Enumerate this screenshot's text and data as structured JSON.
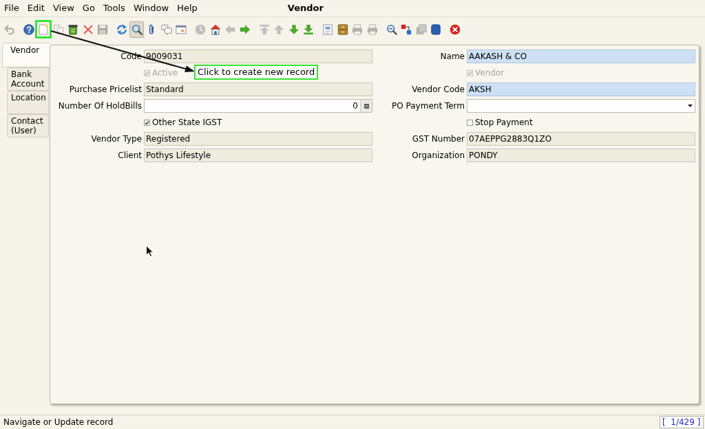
{
  "window": {
    "title": "Vendor"
  },
  "menu": [
    "File",
    "Edit",
    "View",
    "Go",
    "Tools",
    "Window",
    "Help"
  ],
  "toolbar": {
    "groups": [
      {
        "buttons": [
          {
            "disabled": true,
            "pressed": false,
            "highlighted": false
          }
        ]
      },
      {
        "buttons": [
          {
            "disabled": false,
            "pressed": false,
            "highlighted": false
          },
          {
            "disabled": false,
            "pressed": false,
            "highlighted": true
          },
          {
            "disabled": true,
            "pressed": false,
            "highlighted": false
          },
          {
            "disabled": false,
            "pressed": false,
            "highlighted": false
          },
          {
            "disabled": false,
            "pressed": false,
            "highlighted": false
          },
          {
            "disabled": true,
            "pressed": false,
            "highlighted": false
          }
        ]
      },
      {
        "buttons": [
          {
            "disabled": false,
            "pressed": false,
            "highlighted": false
          },
          {
            "disabled": false,
            "pressed": true,
            "highlighted": false
          },
          {
            "disabled": false,
            "pressed": false,
            "highlighted": false
          },
          {
            "disabled": false,
            "pressed": false,
            "highlighted": false
          },
          {
            "disabled": false,
            "pressed": false,
            "highlighted": false
          }
        ]
      },
      {
        "buttons": [
          {
            "disabled": true,
            "pressed": false,
            "highlighted": false
          },
          {
            "disabled": false,
            "pressed": false,
            "highlighted": false
          },
          {
            "disabled": true,
            "pressed": false,
            "highlighted": false
          },
          {
            "disabled": false,
            "pressed": false,
            "highlighted": false
          }
        ]
      },
      {
        "buttons": [
          {
            "disabled": true,
            "pressed": false,
            "highlighted": false
          },
          {
            "disabled": true,
            "pressed": false,
            "highlighted": false
          },
          {
            "disabled": false,
            "pressed": false,
            "highlighted": false
          },
          {
            "disabled": false,
            "pressed": false,
            "highlighted": false
          }
        ]
      },
      {
        "buttons": [
          {
            "disabled": false,
            "pressed": false,
            "highlighted": false
          },
          {
            "disabled": false,
            "pressed": false,
            "highlighted": false
          },
          {
            "disabled": true,
            "pressed": false,
            "highlighted": false
          },
          {
            "disabled": true,
            "pressed": false,
            "highlighted": false
          }
        ]
      },
      {
        "buttons": [
          {
            "disabled": false,
            "pressed": false,
            "highlighted": false
          },
          {
            "disabled": false,
            "pressed": false,
            "highlighted": false
          },
          {
            "disabled": true,
            "pressed": false,
            "highlighted": false
          },
          {
            "disabled": false,
            "pressed": false,
            "highlighted": false
          }
        ]
      },
      {
        "buttons": [
          {
            "disabled": false,
            "pressed": false,
            "highlighted": false
          }
        ]
      }
    ]
  },
  "tabs": [
    {
      "label": "Vendor",
      "selected": true
    },
    {
      "label": "Bank Account",
      "selected": false
    },
    {
      "label": "Location",
      "selected": false
    },
    {
      "label": "Contact (User)",
      "selected": false
    }
  ],
  "fields": [
    {
      "kind": "text",
      "label": "Code",
      "value": "9009031",
      "read_only": true,
      "mandatory": false
    },
    {
      "kind": "text",
      "label": "Name",
      "value": "AAKASH & CO",
      "read_only": false,
      "mandatory": true
    },
    {
      "kind": "checkbox",
      "label": "Active",
      "checked": true,
      "disabled": true
    },
    {
      "kind": "checkbox",
      "label": "Vendor",
      "checked": true,
      "disabled": true
    },
    {
      "kind": "text",
      "label": "Purchase Pricelist",
      "value": "Standard",
      "read_only": true,
      "mandatory": false
    },
    {
      "kind": "text",
      "label": "Vendor Code",
      "value": "AKSH",
      "read_only": false,
      "mandatory": true
    },
    {
      "kind": "number",
      "label": "Number Of HoldBills",
      "value": "0",
      "read_only": false,
      "mandatory": false
    },
    {
      "kind": "select",
      "label": "PO Payment Term",
      "read_only": false,
      "mandatory": false
    },
    {
      "kind": "checkbox",
      "label": "Other State IGST",
      "checked": true,
      "disabled": false
    },
    {
      "kind": "checkbox",
      "label": "Stop Payment",
      "checked": false,
      "disabled": false
    },
    {
      "kind": "text",
      "label": "Vendor Type",
      "value": "Registered",
      "read_only": true,
      "mandatory": false
    },
    {
      "kind": "text",
      "label": "GST Number",
      "value": "07AEPPG2883Q1ZO",
      "read_only": true,
      "mandatory": false
    },
    {
      "kind": "text",
      "label": "Client",
      "value": "Pothys Lifestyle",
      "read_only": true,
      "mandatory": false
    },
    {
      "kind": "text",
      "label": "Organization",
      "value": "PONDY",
      "read_only": true,
      "mandatory": false
    }
  ],
  "annotation": {
    "callout": "Click to create new record"
  },
  "status_bar": {
    "message": "Navigate or Update record",
    "record_counter": "[  1/429 ]"
  }
}
